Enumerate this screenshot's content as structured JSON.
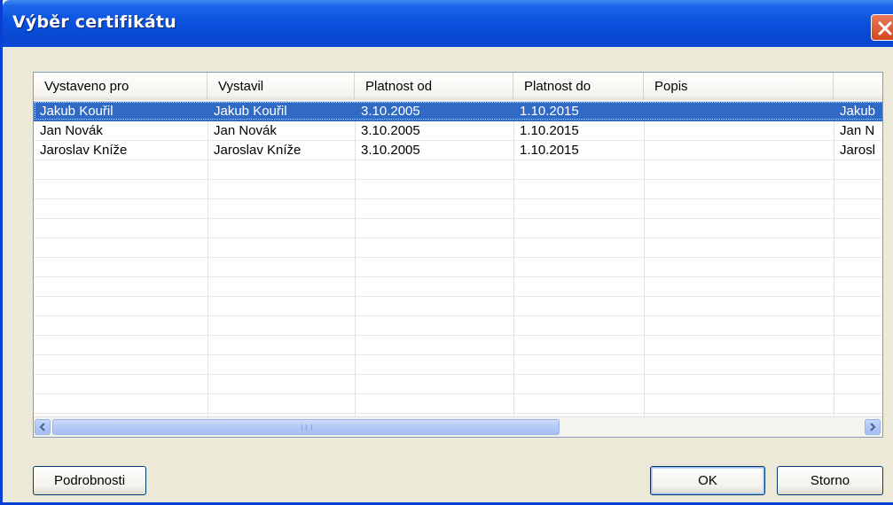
{
  "window": {
    "title": "Výběr certifikátu"
  },
  "columns": [
    "Vystaveno pro",
    "Vystavil",
    "Platnost od",
    "Platnost do",
    "Popis",
    ""
  ],
  "rows": [
    {
      "issued_to": "Jakub Kouřil",
      "issued_by": "Jakub Kouřil",
      "valid_from": "3.10.2005",
      "valid_to": "1.10.2015",
      "description": "",
      "extra": "Jakub",
      "selected": true
    },
    {
      "issued_to": "Jan Novák",
      "issued_by": "Jan Novák",
      "valid_from": "3.10.2005",
      "valid_to": "1.10.2015",
      "description": "",
      "extra": "Jan N",
      "selected": false
    },
    {
      "issued_to": "Jaroslav Kníže",
      "issued_by": "Jaroslav Kníže",
      "valid_from": "3.10.2005",
      "valid_to": "1.10.2015",
      "description": "",
      "extra": "Jarosl",
      "selected": false
    }
  ],
  "buttons": {
    "details": "Podrobnosti",
    "ok": "OK",
    "cancel": "Storno"
  },
  "icons": {
    "close": "close-icon",
    "scroll_left": "chevron-left-icon",
    "scroll_right": "chevron-right-icon"
  },
  "colors": {
    "titlebar": "#0b52de",
    "selection": "#316ac5",
    "close": "#d4471f"
  }
}
